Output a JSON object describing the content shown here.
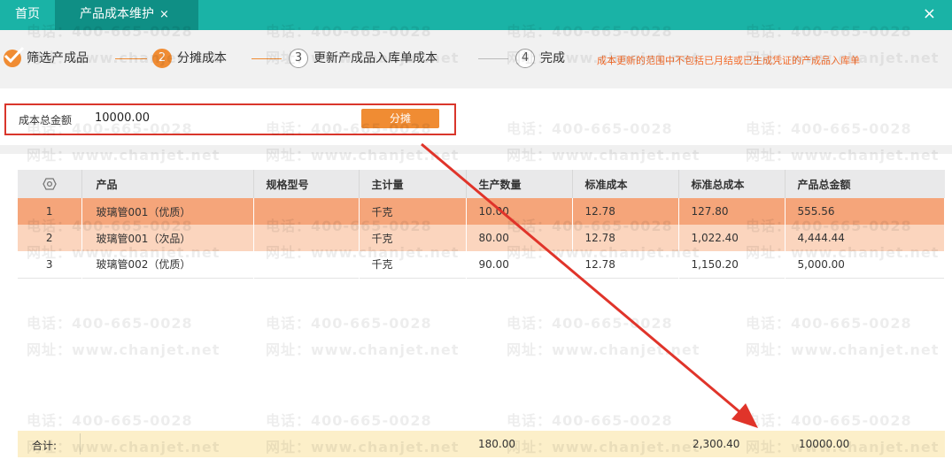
{
  "tabs": {
    "home_label": "首页",
    "active_label": "产品成本维护",
    "close_glyph": "×",
    "window_close_glyph": "×"
  },
  "steps": {
    "items": [
      {
        "num": "",
        "label": "筛选产成品",
        "state": "done"
      },
      {
        "num": "2",
        "label": "分摊成本",
        "state": "current"
      },
      {
        "num": "3",
        "label": "更新产成品入库单成本",
        "state": "todo"
      },
      {
        "num": "4",
        "label": "完成",
        "state": "todo"
      }
    ],
    "notice": "成本更新的范围中不包括已月结或已生成凭证的产成品入库单"
  },
  "allocation": {
    "label": "成本总金额",
    "value": "10000.00",
    "button_label": "分摊"
  },
  "table": {
    "headers": [
      "",
      "产品",
      "规格型号",
      "主计量",
      "生产数量",
      "标准成本",
      "标准总成本",
      "产品总金额"
    ],
    "rows": [
      {
        "idx": "1",
        "product": "玻璃管001（优质）",
        "spec": "",
        "unit": "千克",
        "qty": "10.00",
        "std_cost": "12.78",
        "std_total": "127.80",
        "total": "555.56"
      },
      {
        "idx": "2",
        "product": "玻璃管001（次品）",
        "spec": "",
        "unit": "千克",
        "qty": "80.00",
        "std_cost": "12.78",
        "std_total": "1,022.40",
        "total": "4,444.44"
      },
      {
        "idx": "3",
        "product": "玻璃管002（优质）",
        "spec": "",
        "unit": "千克",
        "qty": "90.00",
        "std_cost": "12.78",
        "std_total": "1,150.20",
        "total": "5,000.00"
      }
    ],
    "totals": {
      "label": "合计:",
      "qty": "180.00",
      "std_total": "2,300.40",
      "total": "10000.00"
    }
  },
  "watermark": {
    "phone": "电话：400-665-0028",
    "site": "网址：www.chanjet.net"
  },
  "colors": {
    "tab_bar": "#1ab3a6",
    "accent": "#f08c33",
    "highlight_border": "#d9362b",
    "arrow": "#e0342a",
    "row_1": "#f5a57a",
    "row_2": "#fbd5be",
    "totals_bg": "#fcefc9"
  }
}
